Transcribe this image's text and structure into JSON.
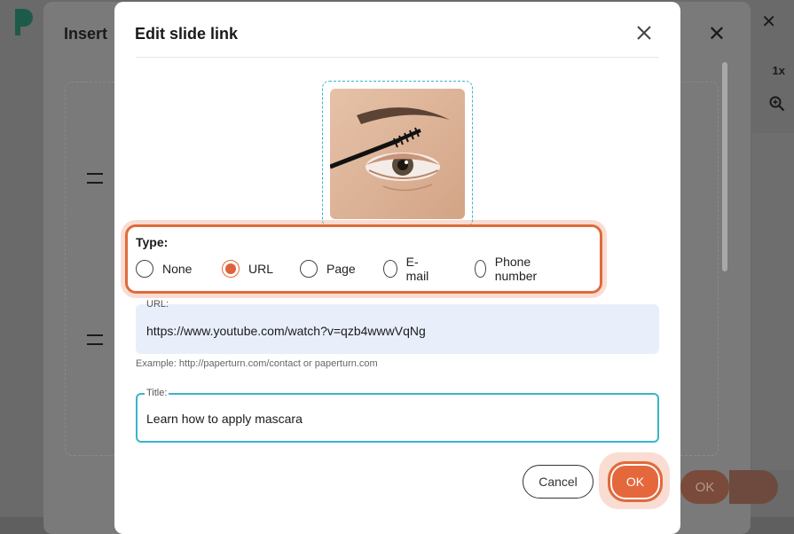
{
  "background": {
    "dialog_title": "Insert",
    "zoom_label": "1x",
    "ok_label": "OK"
  },
  "modal": {
    "title": "Edit slide link",
    "close_icon": "close-icon",
    "image_alt": "Eye with mascara brush thumbnail",
    "type": {
      "label": "Type:",
      "options": [
        {
          "label": "None",
          "checked": false
        },
        {
          "label": "URL",
          "checked": true
        },
        {
          "label": "Page",
          "checked": false
        },
        {
          "label": "E-mail",
          "checked": false
        },
        {
          "label": "Phone number",
          "checked": false
        }
      ]
    },
    "url": {
      "label": "URL:",
      "value": "https://www.youtube.com/watch?v=qzb4wwwVqNg",
      "hint": "Example: http://paperturn.com/contact or paperturn.com"
    },
    "title_field": {
      "label": "Title:",
      "value": "Learn how to apply mascara"
    },
    "buttons": {
      "cancel": "Cancel",
      "ok": "OK"
    }
  },
  "colors": {
    "accent": "#e5683d",
    "focus": "#39b5c8",
    "url_field_bg": "#e8effa"
  }
}
